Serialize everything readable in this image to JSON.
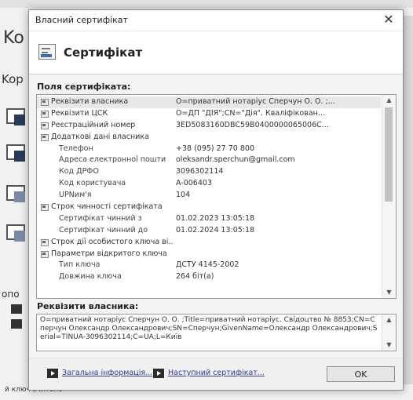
{
  "background": {
    "header_strip": "",
    "big_title": "Ko",
    "subtitle": "Kop",
    "side_label": "опо",
    "status_text": "й ключ зчитано"
  },
  "dialog": {
    "window_title": "Власний сертифікат",
    "close_glyph": "✕",
    "header_title": "Сертифікат",
    "fields_label": "Поля сертифіката:",
    "fields": [
      {
        "name": "Реквізити власника",
        "value": "О=приватний нотаріус Сперчун О. О. ;...",
        "level": 0,
        "selected": true
      },
      {
        "name": "Реквізити ЦСК",
        "value": "О=ДП \"ДІЯ\";CN=\"Дія\". Кваліфікован...",
        "level": 0
      },
      {
        "name": "Реєстраційний номер",
        "value": "3ED5083160DBC59B0400000065006C...",
        "level": 0
      },
      {
        "name": "Додаткові дані власника",
        "value": "",
        "level": 0
      },
      {
        "name": "Телефон",
        "value": "+38 (095) 27 70 800",
        "level": 1
      },
      {
        "name": "Адреса електронної пошти",
        "value": "oleksandr.sperchun@gmail.com",
        "level": 1
      },
      {
        "name": "Код ДРФО",
        "value": "3096302114",
        "level": 1
      },
      {
        "name": "Код користувача",
        "value": "A-006403",
        "level": 1
      },
      {
        "name": "UPNим'я",
        "value": "104",
        "level": 1
      },
      {
        "name": "Строк чинності сертифіката",
        "value": "",
        "level": 0
      },
      {
        "name": "Сертифікат чинний з",
        "value": "01.02.2023 13:05:18",
        "level": 1
      },
      {
        "name": "Сертифікат чинний до",
        "value": "01.02.2024 13:05:18",
        "level": 1
      },
      {
        "name": "Строк дії особистого ключа ві...",
        "value": "",
        "level": 0
      },
      {
        "name": "Параметри відкритого ключа",
        "value": "",
        "level": 0
      },
      {
        "name": "Тип ключа",
        "value": "ДСТУ 4145-2002",
        "level": 1
      },
      {
        "name": "Довжина ключа",
        "value": "264 біт(а)",
        "level": 1
      }
    ],
    "details_label": "Реквізити власника:",
    "details_text": "О=приватний нотаріус Сперчун О. О. ;Title=приватний нотаріус. Свідоцтво № 8853;CN=Сперчун Олександр Олександрович;SN=Сперчун;GivenName=Олександр Олександрович;Serial=TINUA-3096302114;C=UA;L=Київ",
    "footer": {
      "general_info_label": "Загальна інформація...",
      "next_cert_label": "Наступний сертифікат...",
      "ok_label": "OK"
    }
  }
}
